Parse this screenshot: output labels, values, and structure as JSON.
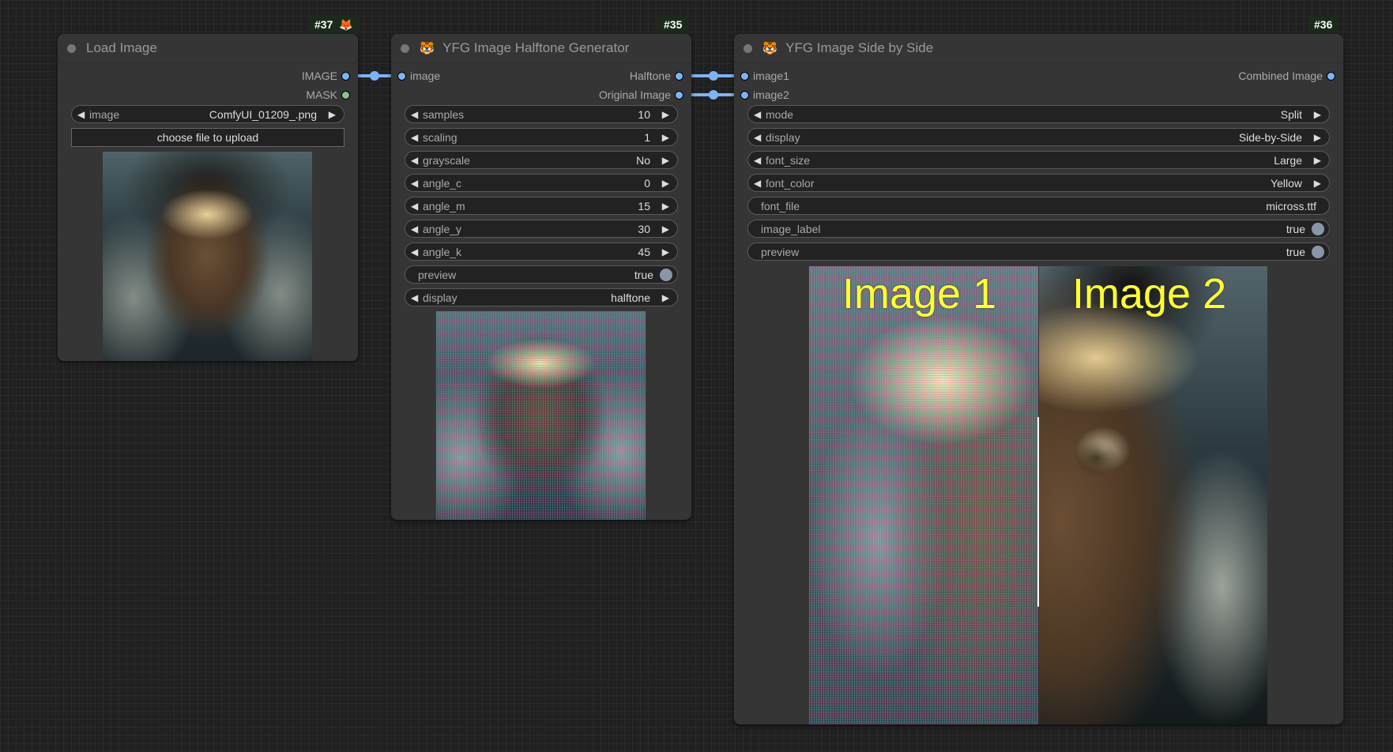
{
  "nodes": {
    "load_image": {
      "id_badge": "#37",
      "badge_emoji": "🦊",
      "title": "Load Image",
      "outputs": [
        {
          "label": "IMAGE",
          "type": "image"
        },
        {
          "label": "MASK",
          "type": "mask"
        }
      ],
      "widgets": {
        "image": {
          "label": "image",
          "value": "ComfyUI_01209_.png"
        }
      },
      "upload_button": "choose file to upload"
    },
    "halftone": {
      "id_badge": "#35",
      "title_emoji": "🐯",
      "title": "YFG Image Halftone Generator",
      "inputs": [
        {
          "label": "image"
        }
      ],
      "outputs": [
        {
          "label": "Halftone"
        },
        {
          "label": "Original Image"
        }
      ],
      "widgets": [
        {
          "label": "samples",
          "value": "10",
          "kind": "combo"
        },
        {
          "label": "scaling",
          "value": "1",
          "kind": "combo"
        },
        {
          "label": "grayscale",
          "value": "No",
          "kind": "combo"
        },
        {
          "label": "angle_c",
          "value": "0",
          "kind": "combo"
        },
        {
          "label": "angle_m",
          "value": "15",
          "kind": "combo"
        },
        {
          "label": "angle_y",
          "value": "30",
          "kind": "combo"
        },
        {
          "label": "angle_k",
          "value": "45",
          "kind": "combo"
        },
        {
          "label": "preview",
          "value": "true",
          "kind": "toggle"
        },
        {
          "label": "display",
          "value": "halftone",
          "kind": "combo"
        }
      ]
    },
    "side_by_side": {
      "id_badge": "#36",
      "title_emoji": "🐯",
      "title": "YFG Image Side by Side",
      "inputs": [
        {
          "label": "image1"
        },
        {
          "label": "image2"
        }
      ],
      "outputs": [
        {
          "label": "Combined Image"
        }
      ],
      "widgets": [
        {
          "label": "mode",
          "value": "Split",
          "kind": "combo"
        },
        {
          "label": "display",
          "value": "Side-by-Side",
          "kind": "combo"
        },
        {
          "label": "font_size",
          "value": "Large",
          "kind": "combo"
        },
        {
          "label": "font_color",
          "value": "Yellow",
          "kind": "combo"
        },
        {
          "label": "font_file",
          "value": "micross.ttf",
          "kind": "text"
        },
        {
          "label": "image_label",
          "value": "true",
          "kind": "toggle"
        },
        {
          "label": "preview",
          "value": "true",
          "kind": "toggle"
        }
      ],
      "preview_labels": {
        "left": "Image 1",
        "right": "Image 2"
      }
    }
  },
  "icons": {
    "arrow_left": "◀",
    "arrow_right": "▶"
  },
  "colors": {
    "image_link": "#7db4f5",
    "mask_slot": "#8bc38b",
    "label_font": "#ffff33"
  }
}
